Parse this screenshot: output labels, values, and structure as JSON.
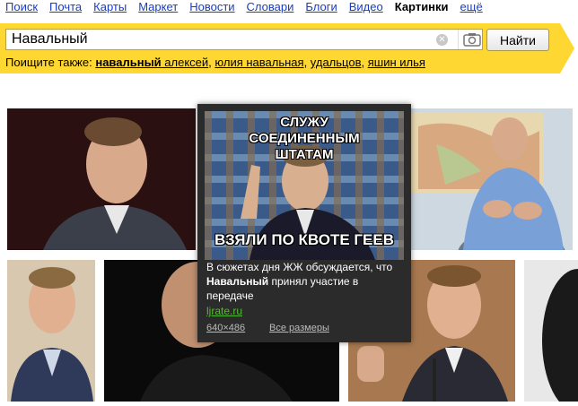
{
  "nav": {
    "items": [
      "Поиск",
      "Почта",
      "Карты",
      "Маркет",
      "Новости",
      "Словари",
      "Блоги",
      "Видео"
    ],
    "active": "Картинки",
    "more": "ещё"
  },
  "search": {
    "value": "Навальный",
    "button": "Найти"
  },
  "suggest": {
    "prefix": "Поищите также:",
    "items": [
      {
        "bold": "навальный",
        "rest": " алексей"
      },
      {
        "bold": "",
        "rest": "юлия навальная"
      },
      {
        "bold": "",
        "rest": "удальцов"
      },
      {
        "bold": "",
        "rest": "яшин илья"
      }
    ]
  },
  "popup": {
    "caption_top": "СЛУЖУ СОЕДИНЕННЫМ ШТАТАМ",
    "caption_bottom": "ВЗЯЛИ ПО КВОТЕ ГЕЕВ",
    "desc_before": "В сюжетах дня ЖЖ обсуждается, что ",
    "desc_bold": "Навальный",
    "desc_after": " принял участие в передаче",
    "site": "ljrate.ru",
    "size": "640×486",
    "all_sizes": "Все размеры"
  },
  "colors": {
    "yellow": "#ffd732",
    "link": "#1a3dc1",
    "popup_bg": "#2b2b2b",
    "site": "#55bb33"
  }
}
